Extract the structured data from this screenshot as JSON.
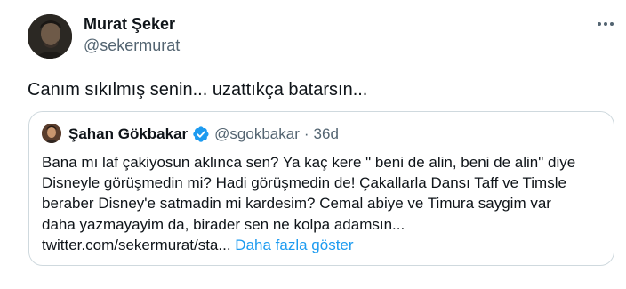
{
  "tweet": {
    "author": {
      "name": "Murat Şeker",
      "handle": "@sekermurat"
    },
    "text": "Canım sıkılmış senin... uzattıkça batarsın...",
    "more_icon": "more-horizontal-icon"
  },
  "quoted": {
    "author": {
      "name": "Şahan Gökbakar",
      "handle": "@sgokbakar",
      "verified": true,
      "verified_color": "#1d9bf0"
    },
    "separator": "·",
    "time": "36d",
    "lines": [
      "Bana mı laf çakiyosun aklınca sen? Ya kaç kere \" beni de alin, beni de alin\" diye",
      "Disneyle görüşmedin mi? Hadi görüşmedin de! Çakallarla Dansı Taff ve Timsle",
      "beraber Disney'e satmadin mi kardesim? Cemal abiye ve Timura saygim var",
      "daha yazmayayim da, birader sen ne kolpa adamsın..."
    ],
    "link": "twitter.com/sekermurat/sta...",
    "show_more": "Daha fazla göster"
  },
  "colors": {
    "text": "#0f1419",
    "secondary": "#536471",
    "accent": "#1d9bf0",
    "border": "#cfd9de"
  }
}
